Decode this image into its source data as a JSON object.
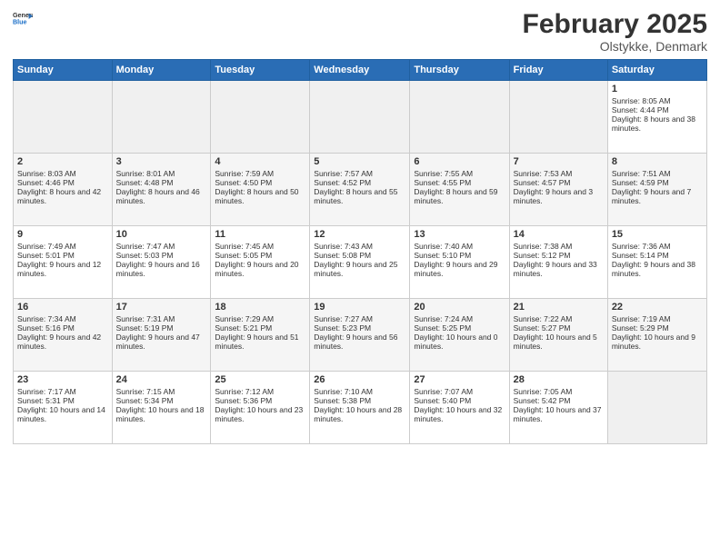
{
  "header": {
    "logo_general": "General",
    "logo_blue": "Blue",
    "title": "February 2025",
    "location": "Olstykke, Denmark"
  },
  "days_of_week": [
    "Sunday",
    "Monday",
    "Tuesday",
    "Wednesday",
    "Thursday",
    "Friday",
    "Saturday"
  ],
  "weeks": [
    [
      {
        "day": "",
        "empty": true
      },
      {
        "day": "",
        "empty": true
      },
      {
        "day": "",
        "empty": true
      },
      {
        "day": "",
        "empty": true
      },
      {
        "day": "",
        "empty": true
      },
      {
        "day": "",
        "empty": true
      },
      {
        "day": "1",
        "sunrise": "Sunrise: 8:05 AM",
        "sunset": "Sunset: 4:44 PM",
        "daylight": "Daylight: 8 hours and 38 minutes."
      }
    ],
    [
      {
        "day": "2",
        "sunrise": "Sunrise: 8:03 AM",
        "sunset": "Sunset: 4:46 PM",
        "daylight": "Daylight: 8 hours and 42 minutes."
      },
      {
        "day": "3",
        "sunrise": "Sunrise: 8:01 AM",
        "sunset": "Sunset: 4:48 PM",
        "daylight": "Daylight: 8 hours and 46 minutes."
      },
      {
        "day": "4",
        "sunrise": "Sunrise: 7:59 AM",
        "sunset": "Sunset: 4:50 PM",
        "daylight": "Daylight: 8 hours and 50 minutes."
      },
      {
        "day": "5",
        "sunrise": "Sunrise: 7:57 AM",
        "sunset": "Sunset: 4:52 PM",
        "daylight": "Daylight: 8 hours and 55 minutes."
      },
      {
        "day": "6",
        "sunrise": "Sunrise: 7:55 AM",
        "sunset": "Sunset: 4:55 PM",
        "daylight": "Daylight: 8 hours and 59 minutes."
      },
      {
        "day": "7",
        "sunrise": "Sunrise: 7:53 AM",
        "sunset": "Sunset: 4:57 PM",
        "daylight": "Daylight: 9 hours and 3 minutes."
      },
      {
        "day": "8",
        "sunrise": "Sunrise: 7:51 AM",
        "sunset": "Sunset: 4:59 PM",
        "daylight": "Daylight: 9 hours and 7 minutes."
      }
    ],
    [
      {
        "day": "9",
        "sunrise": "Sunrise: 7:49 AM",
        "sunset": "Sunset: 5:01 PM",
        "daylight": "Daylight: 9 hours and 12 minutes."
      },
      {
        "day": "10",
        "sunrise": "Sunrise: 7:47 AM",
        "sunset": "Sunset: 5:03 PM",
        "daylight": "Daylight: 9 hours and 16 minutes."
      },
      {
        "day": "11",
        "sunrise": "Sunrise: 7:45 AM",
        "sunset": "Sunset: 5:05 PM",
        "daylight": "Daylight: 9 hours and 20 minutes."
      },
      {
        "day": "12",
        "sunrise": "Sunrise: 7:43 AM",
        "sunset": "Sunset: 5:08 PM",
        "daylight": "Daylight: 9 hours and 25 minutes."
      },
      {
        "day": "13",
        "sunrise": "Sunrise: 7:40 AM",
        "sunset": "Sunset: 5:10 PM",
        "daylight": "Daylight: 9 hours and 29 minutes."
      },
      {
        "day": "14",
        "sunrise": "Sunrise: 7:38 AM",
        "sunset": "Sunset: 5:12 PM",
        "daylight": "Daylight: 9 hours and 33 minutes."
      },
      {
        "day": "15",
        "sunrise": "Sunrise: 7:36 AM",
        "sunset": "Sunset: 5:14 PM",
        "daylight": "Daylight: 9 hours and 38 minutes."
      }
    ],
    [
      {
        "day": "16",
        "sunrise": "Sunrise: 7:34 AM",
        "sunset": "Sunset: 5:16 PM",
        "daylight": "Daylight: 9 hours and 42 minutes."
      },
      {
        "day": "17",
        "sunrise": "Sunrise: 7:31 AM",
        "sunset": "Sunset: 5:19 PM",
        "daylight": "Daylight: 9 hours and 47 minutes."
      },
      {
        "day": "18",
        "sunrise": "Sunrise: 7:29 AM",
        "sunset": "Sunset: 5:21 PM",
        "daylight": "Daylight: 9 hours and 51 minutes."
      },
      {
        "day": "19",
        "sunrise": "Sunrise: 7:27 AM",
        "sunset": "Sunset: 5:23 PM",
        "daylight": "Daylight: 9 hours and 56 minutes."
      },
      {
        "day": "20",
        "sunrise": "Sunrise: 7:24 AM",
        "sunset": "Sunset: 5:25 PM",
        "daylight": "Daylight: 10 hours and 0 minutes."
      },
      {
        "day": "21",
        "sunrise": "Sunrise: 7:22 AM",
        "sunset": "Sunset: 5:27 PM",
        "daylight": "Daylight: 10 hours and 5 minutes."
      },
      {
        "day": "22",
        "sunrise": "Sunrise: 7:19 AM",
        "sunset": "Sunset: 5:29 PM",
        "daylight": "Daylight: 10 hours and 9 minutes."
      }
    ],
    [
      {
        "day": "23",
        "sunrise": "Sunrise: 7:17 AM",
        "sunset": "Sunset: 5:31 PM",
        "daylight": "Daylight: 10 hours and 14 minutes."
      },
      {
        "day": "24",
        "sunrise": "Sunrise: 7:15 AM",
        "sunset": "Sunset: 5:34 PM",
        "daylight": "Daylight: 10 hours and 18 minutes."
      },
      {
        "day": "25",
        "sunrise": "Sunrise: 7:12 AM",
        "sunset": "Sunset: 5:36 PM",
        "daylight": "Daylight: 10 hours and 23 minutes."
      },
      {
        "day": "26",
        "sunrise": "Sunrise: 7:10 AM",
        "sunset": "Sunset: 5:38 PM",
        "daylight": "Daylight: 10 hours and 28 minutes."
      },
      {
        "day": "27",
        "sunrise": "Sunrise: 7:07 AM",
        "sunset": "Sunset: 5:40 PM",
        "daylight": "Daylight: 10 hours and 32 minutes."
      },
      {
        "day": "28",
        "sunrise": "Sunrise: 7:05 AM",
        "sunset": "Sunset: 5:42 PM",
        "daylight": "Daylight: 10 hours and 37 minutes."
      },
      {
        "day": "",
        "empty": true
      }
    ]
  ]
}
